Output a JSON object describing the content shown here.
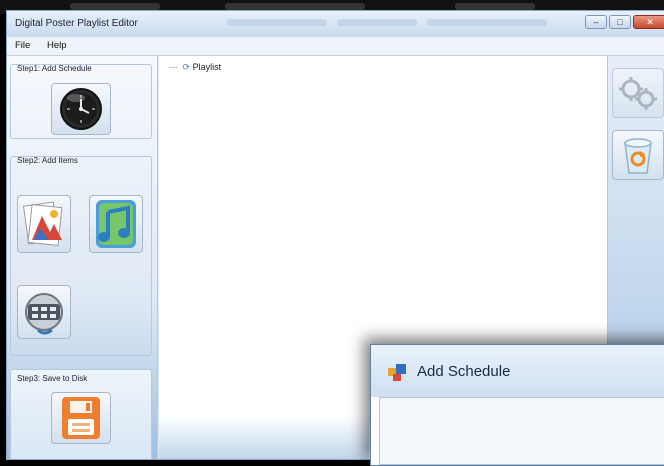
{
  "window": {
    "title": "Digital Poster Playlist Editor"
  },
  "menu": {
    "file": "File",
    "help": "Help"
  },
  "steps": {
    "step1": "Step1: Add Schedule",
    "step2": "Step2: Add Items",
    "step3": "Step3: Save to Disk"
  },
  "tree": {
    "root": "Playlist"
  },
  "dialog": {
    "title": "Add Schedule"
  },
  "colors": {
    "accent": "#c6472e",
    "save": "#ef7e2e"
  }
}
